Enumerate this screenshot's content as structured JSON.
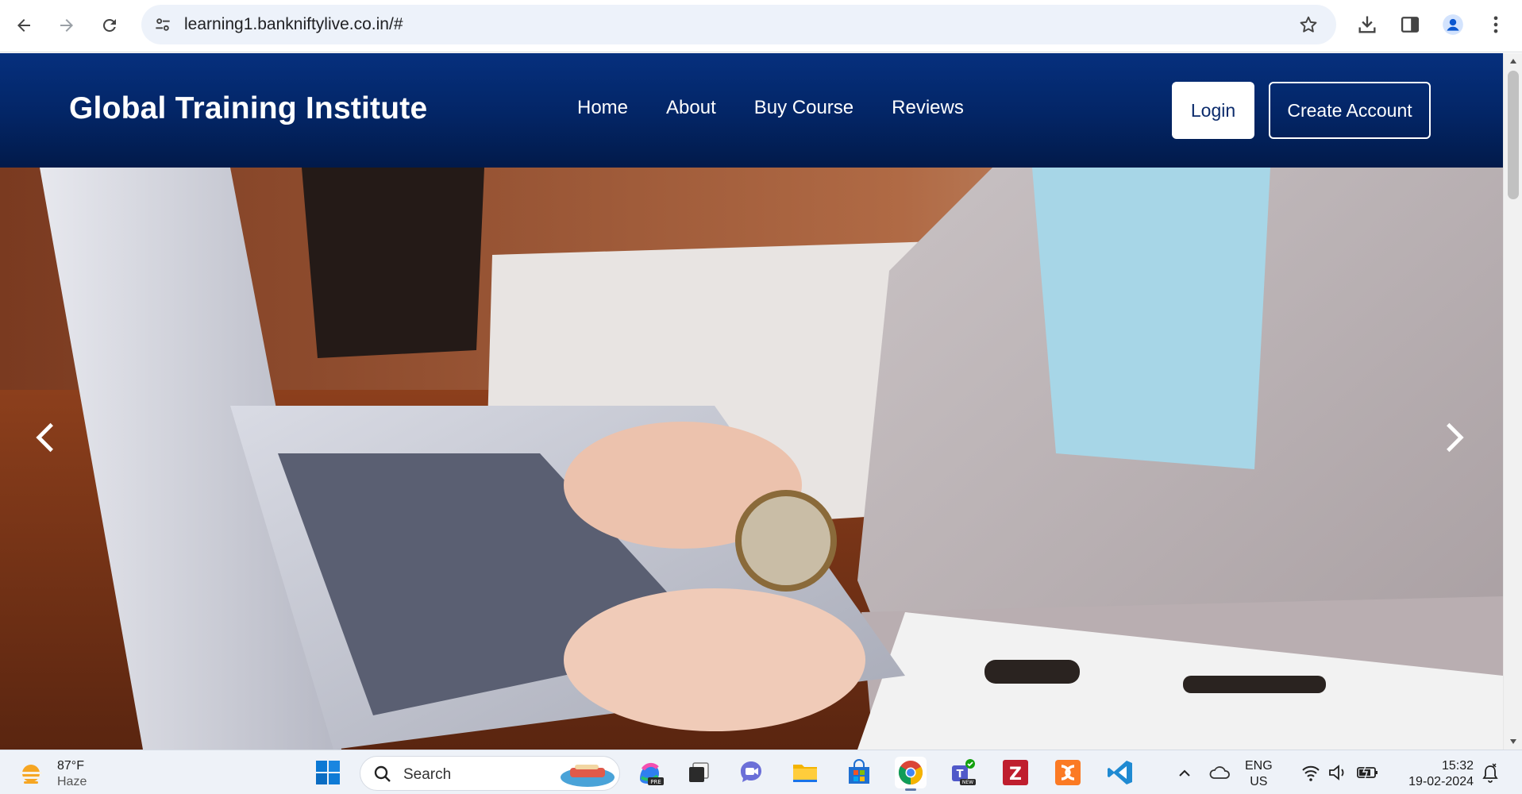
{
  "browser": {
    "url": "learning1.bankniftylive.co.in/#",
    "icons": [
      "back-icon",
      "forward-icon",
      "reload-icon",
      "site-info-icon",
      "bookmark-star-icon",
      "download-icon",
      "side-panel-icon",
      "profile-icon",
      "menu-kebab-icon"
    ]
  },
  "site": {
    "brand": "Global Training Institute",
    "nav": {
      "home": "Home",
      "about": "About",
      "buy_course": "Buy Course",
      "reviews": "Reviews"
    },
    "login": "Login",
    "create_account": "Create Account",
    "colors": {
      "header": "#032565",
      "header_text": "#ffffff"
    },
    "hero": {
      "image": "person typing on laptop at wooden desk",
      "controls": [
        "chevron-left-icon",
        "chevron-right-icon"
      ]
    }
  },
  "taskbar": {
    "weather": {
      "temp": "87°F",
      "condition": "Haze"
    },
    "search_placeholder": "Search",
    "language": {
      "primary": "ENG",
      "secondary": "US"
    },
    "clock": {
      "time": "15:32",
      "date": "19-02-2024"
    },
    "apps": [
      "windows-start-icon",
      "copilot-icon",
      "task-view-icon",
      "teams-chat-icon",
      "file-explorer-icon",
      "microsoft-store-icon",
      "chrome-icon",
      "teams-new-icon",
      "filezilla-icon",
      "xampp-icon",
      "vscode-icon"
    ]
  }
}
